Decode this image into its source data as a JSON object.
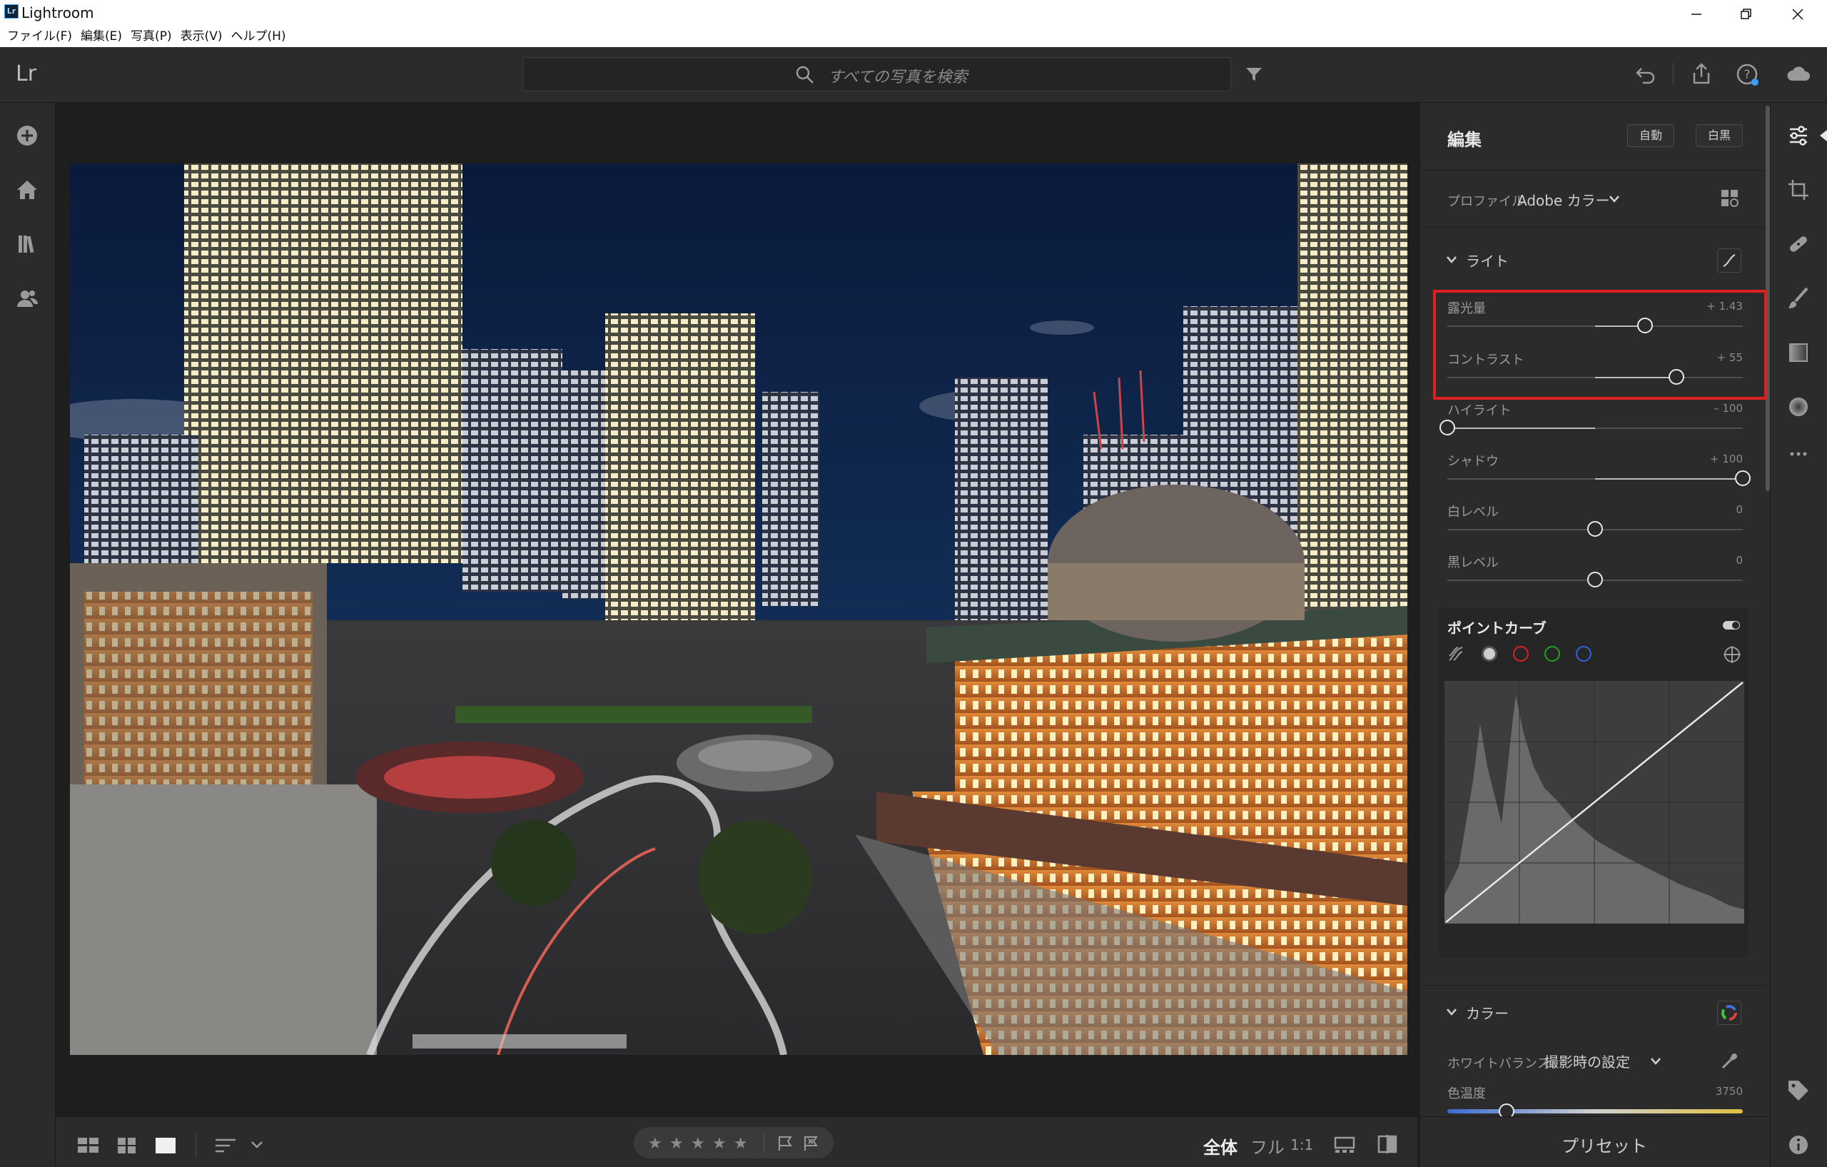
{
  "titlebar": {
    "app_name": "Lightroom",
    "logo_text": "Lr"
  },
  "menu": [
    "ファイル(F)",
    "編集(E)",
    "写真(P)",
    "表示(V)",
    "ヘルプ(H)"
  ],
  "header": {
    "logo": "Lr",
    "search_placeholder": "すべての写真を検索"
  },
  "panel": {
    "title": "編集",
    "auto_label": "自動",
    "bw_label": "白黒",
    "profile_label": "プロファイル",
    "profile_value": "Adobe カラー",
    "light_section": "ライト",
    "sliders": [
      {
        "label": "露光量",
        "value": "+ 1.43",
        "fraction": 0.67
      },
      {
        "label": "コントラスト",
        "value": "+ 55",
        "fraction": 0.775
      },
      {
        "label": "ハイライト",
        "value": "– 100",
        "fraction": 0.0
      },
      {
        "label": "シャドウ",
        "value": "+ 100",
        "fraction": 1.0
      },
      {
        "label": "白レベル",
        "value": "0",
        "fraction": 0.5
      },
      {
        "label": "黒レベル",
        "value": "0",
        "fraction": 0.5
      }
    ],
    "point_curve": "ポイントカーブ",
    "color_section": "カラー",
    "wb_label": "ホワイトバランス",
    "wb_value": "撮影時の設定",
    "temp_label": "色温度",
    "temp_value": "3750",
    "temp_fraction": 0.2
  },
  "bottom": {
    "view_fit": "全体",
    "view_full": "フル",
    "view_1to1": "1:1",
    "presets": "プリセット"
  },
  "colors": {
    "highlight": "#e02020",
    "panel_bg": "#2b2b2b"
  }
}
